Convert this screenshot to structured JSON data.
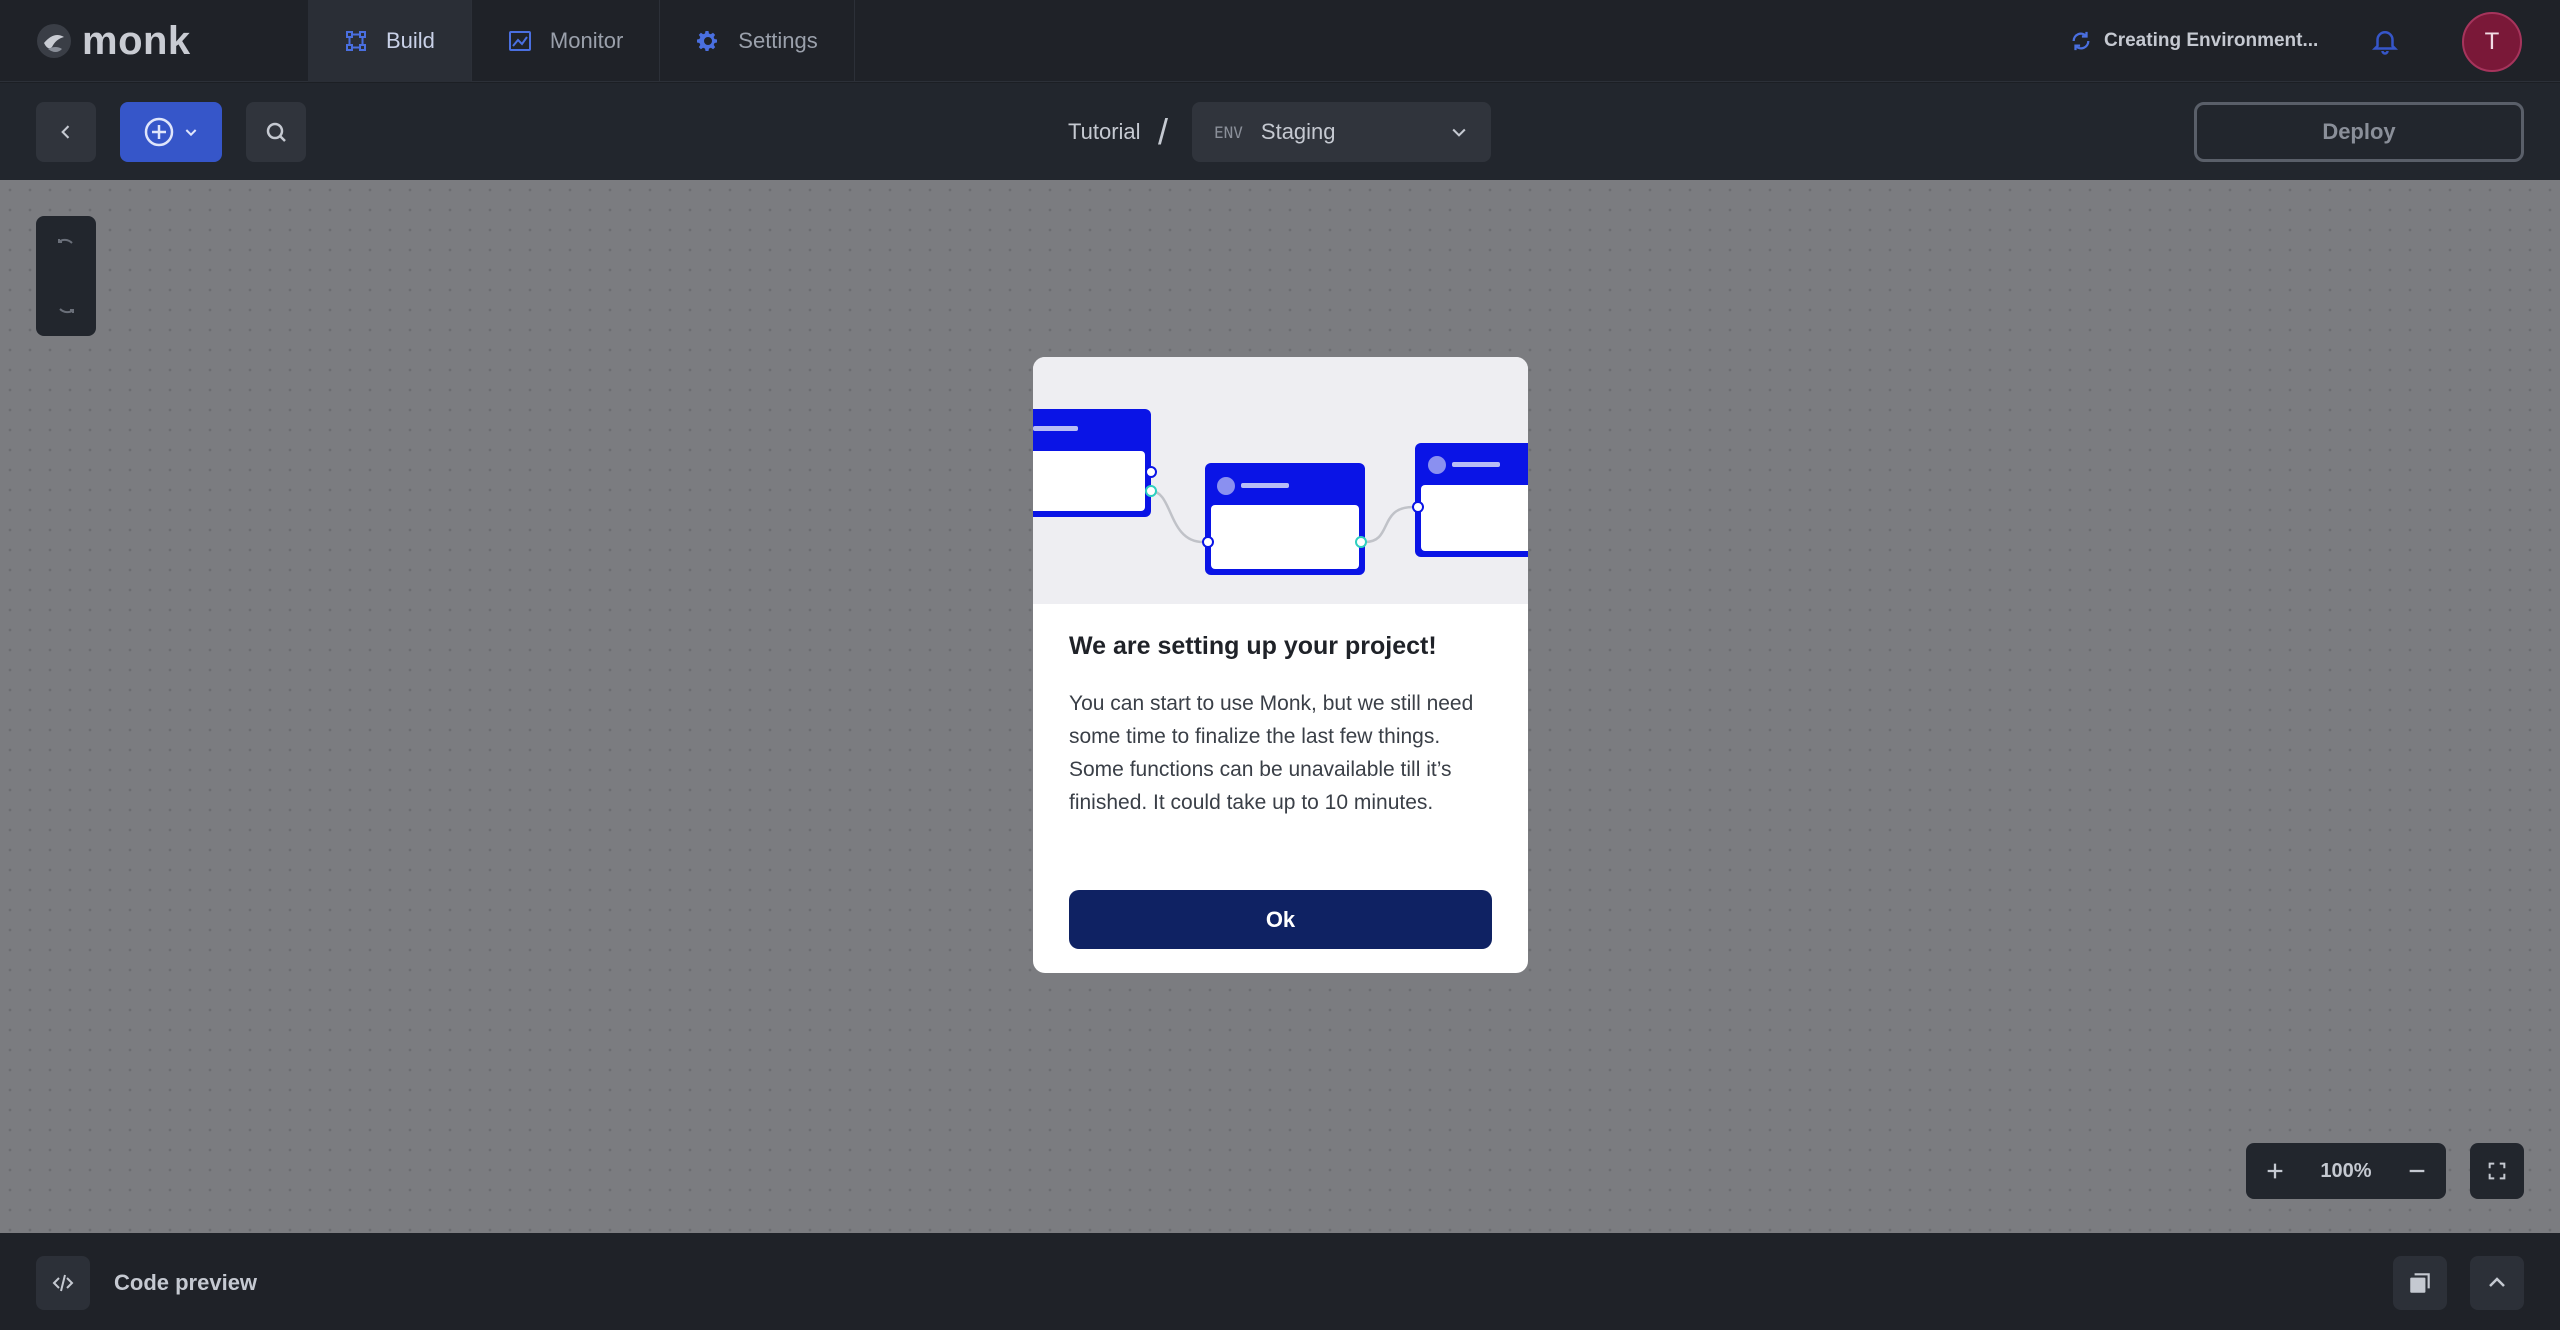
{
  "app": {
    "logo_text": "monk"
  },
  "header": {
    "tabs": [
      {
        "label": "Build",
        "icon": "build-icon",
        "active": true
      },
      {
        "label": "Monitor",
        "icon": "monitor-icon",
        "active": false
      },
      {
        "label": "Settings",
        "icon": "gear-icon",
        "active": false
      }
    ],
    "status_text": "Creating Environment...",
    "avatar_initial": "T"
  },
  "toolbar": {
    "breadcrumb_project": "Tutorial",
    "breadcrumb_separator": "/",
    "env_tag": "ENV",
    "env_name": "Staging",
    "deploy_label": "Deploy"
  },
  "canvas": {
    "zoom_level": "100%"
  },
  "modal": {
    "title": "We are setting up your project!",
    "body": "You can start to use Monk, but we still need some time to finalize the last few things. Some functions can be unavailable till it’s finished. It could take up to 10 minutes.",
    "ok_label": "Ok"
  },
  "bottom": {
    "code_preview_label": "Code preview"
  },
  "colors": {
    "accent": "#3656c9",
    "illustration_blue": "#0a14e6",
    "ok_button": "#0f2263",
    "avatar_bg": "#7a1838"
  }
}
